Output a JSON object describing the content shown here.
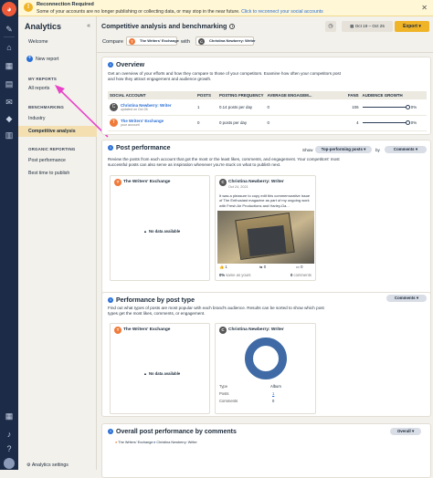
{
  "banner": {
    "title": "Reconnection Required",
    "message": "Some of your accounts are no longer publishing or collecting data, or may stop in the near future.",
    "link": "Click to reconnect your social accounts"
  },
  "sidebar": {
    "title": "Analytics",
    "new_report": "New report",
    "welcome": "Welcome",
    "sec_my_reports": "MY REPORTS",
    "all_reports": "All reports",
    "sec_benchmarking": "BENCHMARKING",
    "industry": "Industry",
    "competitive": "Competitive analysis",
    "sec_organic": "ORGANIC REPORTING",
    "post_performance": "Post performance",
    "best_time": "Best time to publish",
    "settings": "Analytics settings"
  },
  "header": {
    "title": "Competitive analysis and benchmarking",
    "compare": "Compare",
    "with": "with",
    "account_a": "The Writers' Exchange",
    "account_b": "Christina Newberry: Writer",
    "date_range": "Oct 19 – Oct 25",
    "export": "Export"
  },
  "overview": {
    "title": "Overview",
    "description": "Get an overview of your efforts and how they compare to those of your competitors. Examine how often your competitors post and how they attract engagement and audience growth.",
    "columns": [
      "SOCIAL ACCOUNT",
      "POSTS",
      "POSTING FREQUENCY",
      "AVERAGE ENGAGEM...",
      "FANS",
      "AUDIENCE GROWTH"
    ],
    "rows": [
      {
        "name": "Christina Newberry: Writer",
        "sub": "updated on Oct 26",
        "posts": "1",
        "freq": "0.14 posts per day",
        "eng": "0",
        "fans": "106",
        "growth": "0%"
      },
      {
        "name": "The Writers' Exchange",
        "sub": "your account",
        "posts": "0",
        "freq": "0 posts per day",
        "eng": "0",
        "fans": "4",
        "growth": "0%"
      }
    ]
  },
  "post_perf": {
    "title": "Post performance",
    "show": "Show",
    "by": "by",
    "filter": "Top-performing posts",
    "metric": "Comments",
    "description": "Review the posts from each account that got the most or the least likes, comments, and engagement. Your competitors' most successful posts can also serve as inspiration whenever you're stuck on what to publish next.",
    "left_account": "The Writers' Exchange",
    "no_data": "No data available",
    "right_account": "Christina Newberry: Writer",
    "right_date": "Oct 24, 2021",
    "post_text": "It was a pleasure to copy edit this commemorative issue of The Enthusiast magazine as part of my ongoing work with Fresh Air Productions and Harley-Da...",
    "stat_a": "1",
    "stat_b": "0",
    "stat_c": "0",
    "pct": "0%",
    "pct_label": "same as yours",
    "comments_count": "0",
    "comments_label": "comments"
  },
  "by_type": {
    "title": "Performance by post type",
    "metric": "Comments",
    "description": "Find out what types of posts are most popular with each brand's audience. Results can be sorted to show which post types get the most likes, comments, or engagement.",
    "left_account": "The Writers' Exchange",
    "no_data": "No data available",
    "right_account": "Christina Newberry: Writer",
    "type_label": "Type",
    "type_value": "Album",
    "posts_label": "Posts",
    "posts_value": "1",
    "comments_label": "Comments",
    "comments_value": "0"
  },
  "overall": {
    "title": "Overall post performance by comments",
    "metric": "Overall",
    "legend_a": "The Writers' Exchange",
    "legend_b": "Christina Newberry: Writer"
  },
  "colors": {
    "accent": "#f0b429",
    "nav": "#1b2b48",
    "link": "#2a6fd6",
    "donut": "#3f6aa5"
  }
}
